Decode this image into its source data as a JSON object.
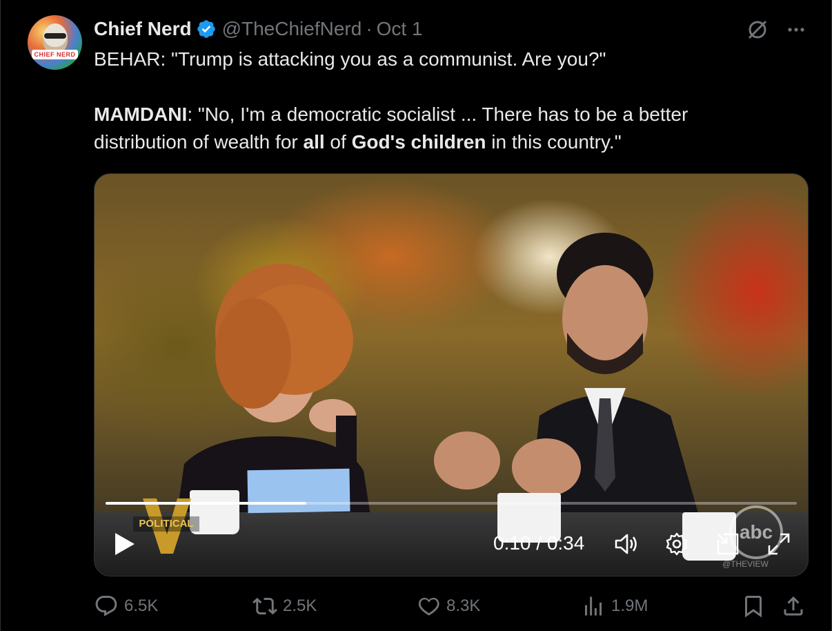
{
  "tweet": {
    "author_name": "Chief Nerd",
    "handle": "@TheChiefNerd",
    "separator": "·",
    "date": "Oct 1",
    "avatar_text": "CHIEF NERD",
    "text": {
      "line1": "BEHAR: \"Trump is attacking you as a communist. Are you?\"",
      "p2_name": "MAMDANI",
      "p2_a": ": \"No, I'm a democratic socialist ... There has to be a better",
      "p2_b": "distribution of wealth for ",
      "p2_bold1": "all",
      "p2_c": " of ",
      "p2_bold2": "God's children",
      "p2_d": " in this country.\""
    }
  },
  "video": {
    "current_time": "0:10",
    "duration": "0:34",
    "time_display": "0:10 / 0:34",
    "progress_fraction": 0.29,
    "overlay_political": "POLITICAL",
    "overlay_abc": "abc",
    "overlay_watermark": "@THEVIEW"
  },
  "actions": {
    "replies": "6.5K",
    "reposts": "2.5K",
    "likes": "8.3K",
    "views": "1.9M"
  },
  "colors": {
    "background": "#000000",
    "text": "#e7e9ea",
    "muted": "#71767b",
    "verified": "#1d9bf0"
  }
}
